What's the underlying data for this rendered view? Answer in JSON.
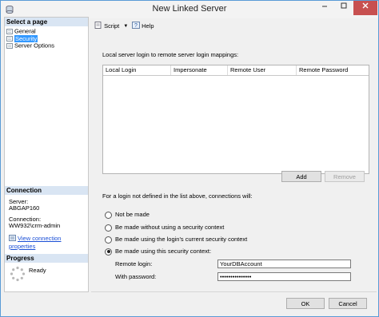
{
  "window": {
    "title": "New Linked Server"
  },
  "left_pane": {
    "select_page_header": "Select a page",
    "pages": [
      {
        "label": "General",
        "icon": "page-icon",
        "selected": false
      },
      {
        "label": "Security",
        "icon": "page-icon",
        "selected": true
      },
      {
        "label": "Server Options",
        "icon": "page-icon",
        "selected": false
      }
    ],
    "connection": {
      "header": "Connection",
      "server_label": "Server:",
      "server_value": "ABGAP160",
      "connection_label": "Connection:",
      "connection_value": "WW932\\crm-admin",
      "view_link": "View connection properties"
    },
    "progress": {
      "header": "Progress",
      "status": "Ready"
    }
  },
  "toolbar": {
    "script_label": "Script",
    "help_label": "Help"
  },
  "security": {
    "mapping_description": "Local server login to remote server login mappings:",
    "columns": [
      "Local Login",
      "Impersonate",
      "Remote User",
      "Remote Password"
    ],
    "add_label": "Add",
    "remove_label": "Remove",
    "undefined_login_text": "For a login not defined in the list above, connections will:",
    "options": [
      {
        "label": "Not be made",
        "selected": false
      },
      {
        "label": "Be made without using a security context",
        "selected": false
      },
      {
        "label": "Be made using the login's current security context",
        "selected": false
      },
      {
        "label": "Be made using this security context:",
        "selected": true
      }
    ],
    "remote_login_label": "Remote login:",
    "remote_login_value": "YourDBAccount",
    "password_label": "With password:",
    "password_value": "•••••••••••••••"
  },
  "footer": {
    "ok_label": "OK",
    "cancel_label": "Cancel"
  },
  "colors": {
    "accent": "#3399ff",
    "title_close": "#c75050",
    "link": "#1a4fd6"
  }
}
